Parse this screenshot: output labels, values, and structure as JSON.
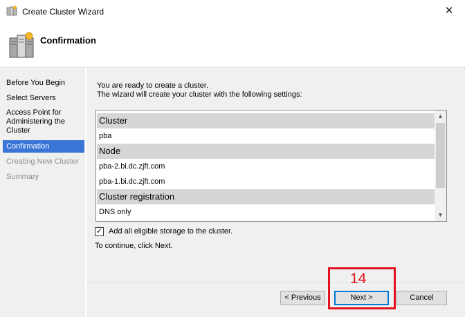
{
  "window": {
    "title": "Create Cluster Wizard",
    "close_glyph": "✕",
    "app_icon": "cluster-app-icon"
  },
  "header": {
    "title": "Confirmation",
    "icon": "cluster-servers-icon"
  },
  "nav": {
    "items": [
      {
        "label": "Before You Begin",
        "state": "normal"
      },
      {
        "label": "Select Servers",
        "state": "normal"
      },
      {
        "label": "Access Point for Administering the Cluster",
        "state": "normal"
      },
      {
        "label": "Confirmation",
        "state": "active"
      },
      {
        "label": "Creating New Cluster",
        "state": "disabled"
      },
      {
        "label": "Summary",
        "state": "disabled"
      }
    ]
  },
  "main": {
    "intro_line1": "You are ready to create a cluster.",
    "intro_line2": "The wizard will create your cluster with the following settings:",
    "settings": [
      {
        "type": "group",
        "text": "Cluster"
      },
      {
        "type": "item",
        "text": "pba"
      },
      {
        "type": "group",
        "text": "Node"
      },
      {
        "type": "item",
        "text": "pba-2.bi.dc.zjft.com"
      },
      {
        "type": "item",
        "text": "pba-1.bi.dc.zjft.com"
      },
      {
        "type": "group",
        "text": "Cluster registration"
      },
      {
        "type": "item",
        "text": "DNS only"
      }
    ],
    "add_storage_checked": true,
    "add_storage_label": "Add all eligible storage to the cluster.",
    "continue_text": "To continue, click Next."
  },
  "buttons": {
    "previous": "< Previous",
    "next": "Next >",
    "cancel": "Cancel"
  },
  "annotation": {
    "step_number": "14",
    "color": "#e0121f"
  },
  "colors": {
    "active_nav": "#3875d7",
    "default_button_border": "#0078d7",
    "group_row": "#d6d6d6"
  }
}
